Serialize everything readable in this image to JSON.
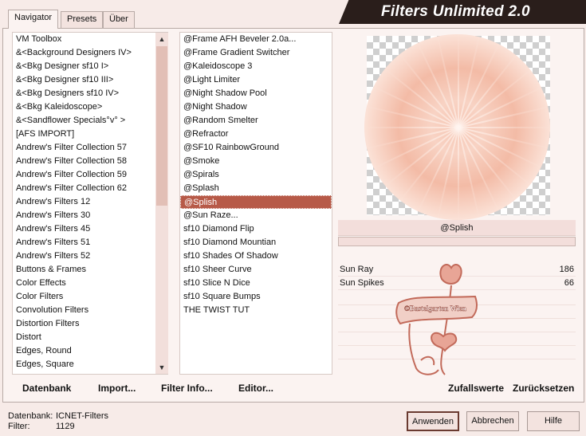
{
  "title": "Filters Unlimited 2.0",
  "tabs": [
    {
      "label": "Navigator"
    },
    {
      "label": "Presets"
    },
    {
      "label": "Über"
    }
  ],
  "categories": [
    "VM Toolbox",
    "&<Background Designers IV>",
    "&<Bkg Designer sf10 I>",
    "&<Bkg Designer sf10 III>",
    "&<Bkg Designers sf10 IV>",
    "&<Bkg Kaleidoscope>",
    "&<Sandflower Specials°v° >",
    "[AFS IMPORT]",
    "Andrew's Filter Collection 57",
    "Andrew's Filter Collection 58",
    "Andrew's Filter Collection 59",
    "Andrew's Filter Collection 62",
    "Andrew's Filters 12",
    "Andrew's Filters 30",
    "Andrew's Filters 45",
    "Andrew's Filters 51",
    "Andrew's Filters 52",
    "Buttons & Frames",
    "Color Effects",
    "Color Filters",
    "Convolution Filters",
    "Distortion Filters",
    "Distort",
    "Edges, Round",
    "Edges, Square"
  ],
  "filters": [
    "@Frame AFH Beveler 2.0a...",
    "@Frame Gradient Switcher",
    "@Kaleidoscope 3",
    "@Light Limiter",
    "@Night Shadow Pool",
    "@Night Shadow",
    "@Random Smelter",
    "@Refractor",
    "@SF10 RainbowGround",
    "@Smoke",
    "@Spirals",
    "@Splash",
    "@Splish",
    "@Sun Raze...",
    "sf10 Diamond Flip",
    "sf10 Diamond Mountian",
    "sf10 Shades Of Shadow",
    "sf10 Sheer Curve",
    "sf10 Slice N Dice",
    "sf10 Square Bumps",
    "THE TWIST TUT"
  ],
  "selected_filter": "@Splish",
  "list_buttons": {
    "database": "Datenbank",
    "import": "Import...",
    "filter_info": "Filter Info...",
    "editor": "Editor..."
  },
  "params": [
    {
      "label": "Sun Ray",
      "value": "186"
    },
    {
      "label": "Sun Spikes",
      "value": "66"
    }
  ],
  "preview_buttons": {
    "random": "Zufallswerte",
    "reset": "Zurücksetzen"
  },
  "watermark_text": "©Bastelgarten Wien",
  "status": {
    "database_label": "Datenbank:",
    "database_value": "ICNET-Filters",
    "filter_label": "Filter:",
    "filter_value": "1129"
  },
  "dialog_buttons": {
    "apply": "Anwenden",
    "cancel": "Abbrechen",
    "help": "Hilfe"
  },
  "colors": {
    "background": "#f7ebe8",
    "selection": "#b75a48",
    "title_bar": "#2a1e1b",
    "preview_peach": "#f6c5b2",
    "watermark": "#c26a5a"
  }
}
